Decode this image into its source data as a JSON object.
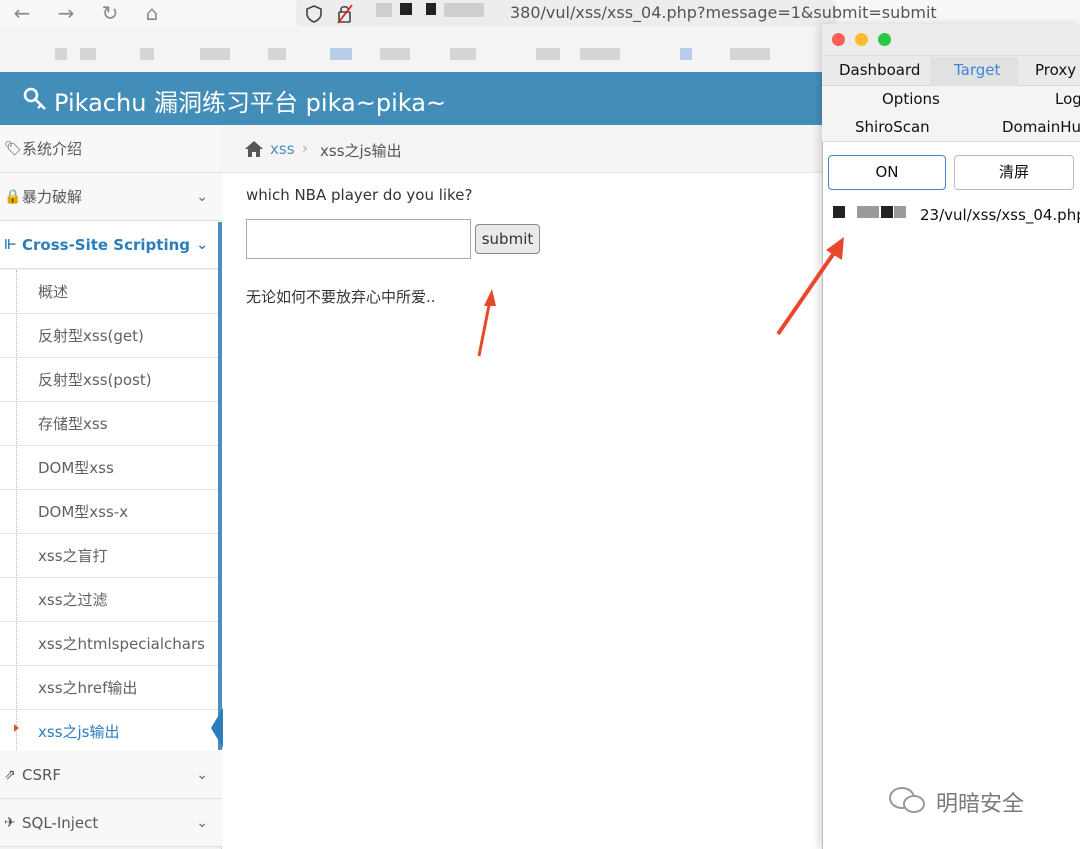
{
  "browser": {
    "url": "380/vul/xss/xss_04.php?message=1&submit=submit",
    "nav": {
      "back": "←",
      "forward": "→",
      "reload": "↻",
      "home": "⌂"
    }
  },
  "header": {
    "title": "Pikachu 漏洞练习平台 pika~pika~",
    "icon": "key-icon"
  },
  "sidebar": {
    "top_items": [
      {
        "label": "系统介绍",
        "icon": "tags-icon"
      },
      {
        "label": "暴力破解",
        "icon": "lock-icon"
      },
      {
        "label": "Cross-Site Scripting",
        "icon": "sitemap-icon"
      },
      {
        "label": "CSRF",
        "icon": "share-icon"
      },
      {
        "label": "SQL-Inject",
        "icon": "plane-icon"
      }
    ],
    "sub_items": [
      {
        "label": "概述"
      },
      {
        "label": "反射型xss(get)"
      },
      {
        "label": "反射型xss(post)"
      },
      {
        "label": "存储型xss"
      },
      {
        "label": "DOM型xss"
      },
      {
        "label": "DOM型xss-x"
      },
      {
        "label": "xss之盲打"
      },
      {
        "label": "xss之过滤"
      },
      {
        "label": "xss之htmlspecialchars"
      },
      {
        "label": "xss之href输出"
      },
      {
        "label": "xss之js输出"
      }
    ]
  },
  "breadcrumb": {
    "home_icon": "home-icon",
    "section": "xss",
    "separator": "›",
    "current": "xss之js输出"
  },
  "main": {
    "question": "which NBA player do you like?",
    "input_value": "",
    "submit_label": "submit",
    "result": "无论如何不要放弃心中所爱.."
  },
  "popup": {
    "tabs": [
      "Dashboard",
      "Target",
      "Proxy"
    ],
    "row2": [
      "Options",
      "Log"
    ],
    "row3": [
      "ShiroScan",
      "DomainHun"
    ],
    "on_label": "ON",
    "clear_label": "清屏",
    "log_entry": "23/vul/xss/xss_04.php"
  },
  "watermark": "明暗安全",
  "colors": {
    "header": "#438eb9",
    "link": "#4c8fbd",
    "arrow": "#e8472c",
    "active_tab": "#3f86d6"
  }
}
